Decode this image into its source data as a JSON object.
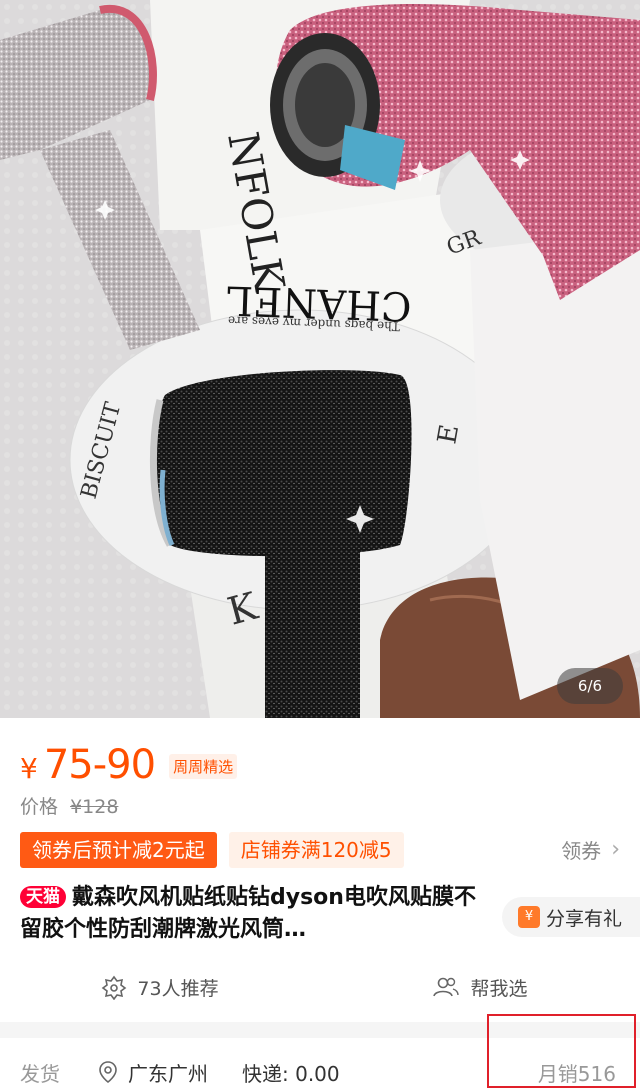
{
  "gallery": {
    "counter": "6/6",
    "photo_texts": {
      "magazine_left": "NFOLK",
      "magazine_center": "CHANEL",
      "magazine_tagline": "The bags under my eyes are",
      "plate_left": "BISCUIT",
      "plate_right": "GR",
      "letter_e": "E",
      "letter_k": "K"
    }
  },
  "price": {
    "currency": "¥",
    "range": "75-90",
    "tag": "周周精选",
    "original_label": "价格",
    "original_value": "¥128"
  },
  "coupons": {
    "coupon_estimate": "领券后预计减2元起",
    "store_coupon": "店铺券满120减5",
    "claim_label": "领券"
  },
  "product": {
    "badge": "天猫",
    "title": "戴森吹风机贴纸贴钻dyson电吹风贴膜不留胶个性防刮潮牌激光风筒…",
    "share_label": "分享有礼"
  },
  "recommend": {
    "recommend_count": "73人推荐",
    "help_choose": "帮我选"
  },
  "shipping": {
    "label": "发货",
    "location": "广东广州",
    "express": "快递: 0.00",
    "monthly_sales": "月销516"
  },
  "colors": {
    "accent": "#ff5000",
    "tmall": "#ff0036",
    "highlight_box": "#e0202a"
  }
}
